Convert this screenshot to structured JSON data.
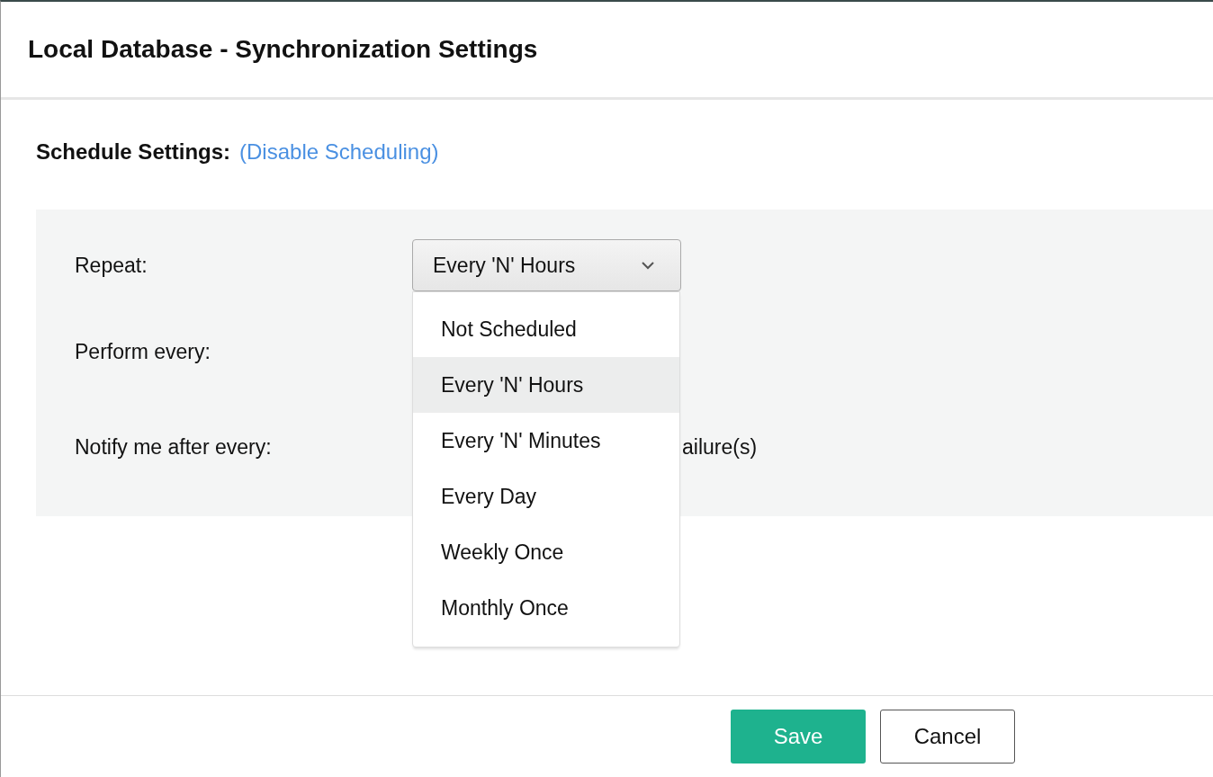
{
  "dialog": {
    "title": "Local Database - Synchronization Settings"
  },
  "schedule": {
    "heading": "Schedule Settings:",
    "link": "(Disable Scheduling)"
  },
  "form": {
    "repeat_label": "Repeat:",
    "repeat_value": "Every 'N' Hours",
    "perform_label": "Perform every:",
    "notify_label": "Notify me after every:",
    "notify_suffix": "ailure(s)"
  },
  "dropdown": {
    "expanded": true,
    "options": [
      {
        "label": "Not Scheduled",
        "selected": false
      },
      {
        "label": "Every 'N' Hours",
        "selected": true
      },
      {
        "label": "Every 'N' Minutes",
        "selected": false
      },
      {
        "label": "Every Day",
        "selected": false
      },
      {
        "label": "Weekly Once",
        "selected": false
      },
      {
        "label": "Monthly Once",
        "selected": false
      }
    ]
  },
  "buttons": [
    {
      "label": "Save",
      "kind": "primary"
    },
    {
      "label": "Cancel",
      "kind": "secondary"
    }
  ]
}
